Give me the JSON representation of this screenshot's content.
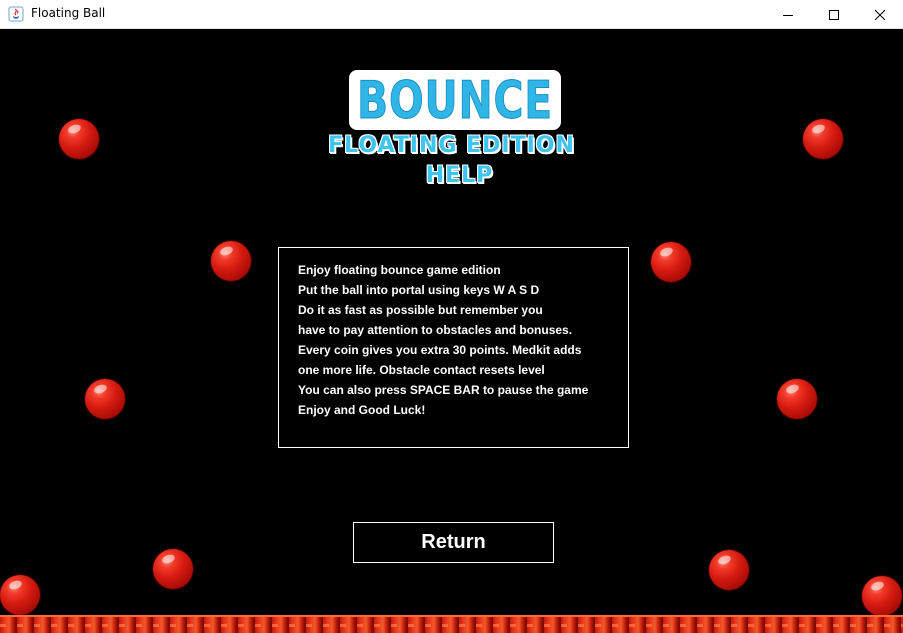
{
  "window": {
    "title": "Floating Ball"
  },
  "logo": {
    "text": "BOUNCE"
  },
  "subtitles": {
    "edition": "FLOATING EDITION",
    "section": "HELP"
  },
  "help": {
    "lines": [
      "Enjoy floating bounce game edition",
      "Put the ball into portal using keys W A S D",
      "Do it as fast as possible but remember you",
      "have to pay attention to obstacles and bonuses.",
      "Every coin gives you extra 30 points. Medkit adds",
      "one more life. Obstacle contact resets level",
      "You can also press SPACE BAR to pause the game",
      "Enjoy and Good Luck!"
    ]
  },
  "buttons": {
    "return_label": "Return"
  },
  "colors": {
    "background": "#000000",
    "title_blue": "#3fc4ef",
    "ball_red": "#d41a10"
  }
}
